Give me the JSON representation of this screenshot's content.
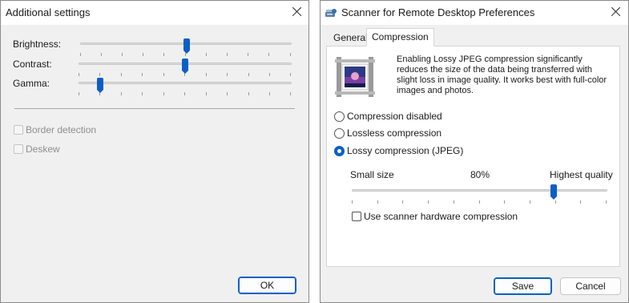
{
  "left_dialog": {
    "title": "Additional settings",
    "sliders": [
      {
        "label": "Brightness:",
        "level": 0.5
      },
      {
        "label": "Contrast:",
        "level": 0.5
      },
      {
        "label": "Gamma:",
        "level": 0.1
      }
    ],
    "checkboxes": [
      {
        "label": "Border detection",
        "checked": false,
        "enabled": false
      },
      {
        "label": "Deskew",
        "checked": false,
        "enabled": false
      }
    ],
    "ok_label": "OK"
  },
  "right_dialog": {
    "title": "Scanner for Remote Desktop Preferences",
    "tabs": [
      {
        "label": "General",
        "active": false
      },
      {
        "label": "Compression",
        "active": true
      }
    ],
    "description": "Enabling Lossy JPEG compression significantly reduces the size of the data being transferred with slight loss in image quality. It works best with full-color images and photos.",
    "radios": [
      {
        "label": "Compression disabled",
        "checked": false
      },
      {
        "label": "Lossless compression",
        "checked": false
      },
      {
        "label": "Lossy compression (JPEG)",
        "checked": true
      }
    ],
    "quality": {
      "min_label": "Small size",
      "value_label": "80%",
      "max_label": "Highest quality",
      "level": 0.8
    },
    "hardware_compression": {
      "label": "Use scanner hardware compression",
      "checked": false
    },
    "save_label": "Save",
    "cancel_label": "Cancel"
  },
  "colors": {
    "accent": "#0a5fc7",
    "dialog_bg": "#f0f0f0",
    "titlebar_bg": "#ffffff"
  }
}
